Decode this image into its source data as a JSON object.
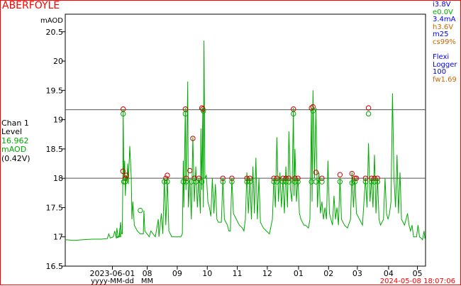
{
  "header": {
    "site_name": "ABERFOYLE",
    "timestamp": "2024-05-08 18:07:06"
  },
  "stats": [
    {
      "text": "i3.8V",
      "color": "#0000ff"
    },
    {
      "text": "e0.0V",
      "color": "#00aa00"
    },
    {
      "text": "3.4mA",
      "color": "#0000ff"
    },
    {
      "text": "h3.6V",
      "color": "#cc6600"
    },
    {
      "text": "m25",
      "color": "#0000ff"
    },
    {
      "text": "cs99%",
      "color": "#cc6600"
    },
    {
      "text": "",
      "color": "#000000"
    },
    {
      "text": "Flexi",
      "color": "#0000ff"
    },
    {
      "text": "Logger",
      "color": "#0000ff"
    },
    {
      "text": "100",
      "color": "#0000ff"
    },
    {
      "text": "fw1.69",
      "color": "#cc6600"
    }
  ],
  "channel": {
    "name": "Chan 1",
    "type": "Level",
    "value": "16.962",
    "unit": "mAOD",
    "voltage": "(0.42V)",
    "value_color": "#00aa00"
  },
  "chart_data": {
    "type": "line",
    "ylabel": "mAOD",
    "ylim": [
      16.5,
      20.8
    ],
    "yticks": [
      16.5,
      17,
      17.5,
      18,
      18.5,
      19,
      19.5,
      20,
      20.5
    ],
    "ytick_labels": [
      "16.5",
      "17",
      "17.5",
      "18",
      "18.5",
      "19",
      "19.5",
      "20",
      "20.5"
    ],
    "xlim": [
      0,
      12
    ],
    "xticks": [
      {
        "x": 1.57,
        "label": "2023-06-01"
      },
      {
        "x": 2.73,
        "label": "08"
      },
      {
        "x": 3.73,
        "label": "09"
      },
      {
        "x": 4.73,
        "label": "10"
      },
      {
        "x": 5.73,
        "label": "11"
      },
      {
        "x": 6.73,
        "label": "12"
      },
      {
        "x": 7.77,
        "label": "01"
      },
      {
        "x": 8.77,
        "label": "02"
      },
      {
        "x": 9.73,
        "label": "03"
      },
      {
        "x": 10.77,
        "label": "04"
      },
      {
        "x": 11.73,
        "label": "05"
      }
    ],
    "xaxis_format_labels": [
      {
        "x": 1.57,
        "label": "yyyy-MM-dd"
      },
      {
        "x": 2.73,
        "label": "MM"
      }
    ],
    "threshold_lines": [
      18.0,
      19.17
    ],
    "series": [
      {
        "color": "#00aa00",
        "points": [
          [
            0.0,
            16.95
          ],
          [
            0.3,
            16.94
          ],
          [
            0.6,
            16.95
          ],
          [
            0.9,
            16.96
          ],
          [
            1.2,
            16.96
          ],
          [
            1.4,
            16.97
          ],
          [
            1.45,
            17.05
          ],
          [
            1.5,
            16.98
          ],
          [
            1.6,
            17.0
          ],
          [
            1.65,
            17.1
          ],
          [
            1.7,
            16.98
          ],
          [
            1.8,
            17.0
          ],
          [
            1.82,
            17.15
          ],
          [
            1.85,
            17.0
          ],
          [
            1.7,
            17.0
          ],
          [
            1.72,
            17.15
          ],
          [
            1.76,
            17.0
          ],
          [
            1.82,
            17.02
          ],
          [
            1.84,
            17.25
          ],
          [
            1.88,
            17.05
          ],
          [
            1.9,
            17.05
          ],
          [
            1.92,
            18.1
          ],
          [
            1.93,
            19.18
          ],
          [
            1.95,
            18.0
          ],
          [
            1.98,
            18.3
          ],
          [
            2.0,
            17.7
          ],
          [
            2.03,
            18.05
          ],
          [
            2.05,
            17.95
          ],
          [
            2.08,
            18.25
          ],
          [
            2.1,
            17.9
          ],
          [
            2.15,
            18.55
          ],
          [
            2.2,
            18.0
          ],
          [
            2.22,
            17.3
          ],
          [
            2.25,
            17.6
          ],
          [
            2.3,
            17.2
          ],
          [
            2.4,
            17.1
          ],
          [
            2.5,
            17.05
          ],
          [
            2.6,
            17.05
          ],
          [
            2.62,
            17.45
          ],
          [
            2.65,
            17.1
          ],
          [
            2.8,
            17.0
          ],
          [
            2.85,
            17.1
          ],
          [
            3.0,
            17.0
          ],
          [
            3.1,
            17.3
          ],
          [
            3.12,
            17.0
          ],
          [
            3.2,
            17.4
          ],
          [
            3.25,
            17.05
          ],
          [
            3.3,
            18.0
          ],
          [
            3.35,
            17.2
          ],
          [
            3.4,
            18.0
          ],
          [
            3.45,
            17.1
          ],
          [
            3.5,
            17.05
          ],
          [
            3.55,
            17.0
          ],
          [
            3.6,
            17.0
          ],
          [
            3.65,
            17.0
          ],
          [
            3.7,
            17.0
          ],
          [
            3.8,
            17.0
          ],
          [
            3.85,
            17.0
          ],
          [
            3.9,
            17.05
          ],
          [
            3.93,
            18.3
          ],
          [
            3.95,
            17.5
          ],
          [
            4.0,
            19.2
          ],
          [
            4.02,
            17.8
          ],
          [
            4.05,
            18.5
          ],
          [
            4.08,
            19.65
          ],
          [
            4.1,
            17.5
          ],
          [
            4.15,
            18.0
          ],
          [
            4.2,
            17.3
          ],
          [
            4.25,
            18.7
          ],
          [
            4.3,
            17.6
          ],
          [
            4.35,
            18.2
          ],
          [
            4.4,
            17.5
          ],
          [
            4.45,
            18.0
          ],
          [
            4.5,
            17.4
          ],
          [
            4.52,
            18.85
          ],
          [
            4.55,
            17.8
          ],
          [
            4.58,
            19.2
          ],
          [
            4.6,
            17.5
          ],
          [
            4.62,
            20.35
          ],
          [
            4.65,
            18.0
          ],
          [
            4.7,
            18.05
          ],
          [
            4.75,
            17.6
          ],
          [
            4.8,
            17.5
          ],
          [
            4.85,
            17.35
          ],
          [
            4.9,
            18.0
          ],
          [
            4.95,
            17.4
          ],
          [
            5.0,
            17.9
          ],
          [
            5.05,
            17.3
          ],
          [
            5.1,
            17.25
          ],
          [
            5.2,
            17.25
          ],
          [
            5.25,
            18.0
          ],
          [
            5.3,
            17.3
          ],
          [
            5.4,
            17.2
          ],
          [
            5.45,
            17.1
          ],
          [
            5.5,
            17.1
          ],
          [
            5.55,
            18.0
          ],
          [
            5.6,
            17.4
          ],
          [
            5.7,
            17.3
          ],
          [
            5.8,
            17.2
          ],
          [
            5.9,
            17.15
          ],
          [
            5.95,
            17.1
          ],
          [
            6.0,
            17.3
          ],
          [
            6.05,
            18.1
          ],
          [
            6.1,
            17.4
          ],
          [
            6.15,
            18.0
          ],
          [
            6.2,
            17.3
          ],
          [
            6.25,
            18.2
          ],
          [
            6.3,
            17.4
          ],
          [
            6.35,
            18.35
          ],
          [
            6.4,
            17.3
          ],
          [
            6.45,
            18.0
          ],
          [
            6.5,
            17.25
          ],
          [
            6.55,
            17.2
          ],
          [
            6.6,
            17.15
          ],
          [
            6.7,
            17.1
          ],
          [
            6.8,
            17.05
          ],
          [
            6.9,
            17.3
          ],
          [
            6.95,
            18.0
          ],
          [
            7.0,
            17.5
          ],
          [
            7.05,
            18.7
          ],
          [
            7.1,
            17.6
          ],
          [
            7.15,
            18.1
          ],
          [
            7.2,
            17.5
          ],
          [
            7.25,
            18.0
          ],
          [
            7.3,
            17.4
          ],
          [
            7.35,
            18.2
          ],
          [
            7.4,
            17.5
          ],
          [
            7.45,
            18.8
          ],
          [
            7.5,
            17.8
          ],
          [
            7.55,
            17.6
          ],
          [
            7.6,
            19.2
          ],
          [
            7.62,
            17.7
          ],
          [
            7.65,
            18.5
          ],
          [
            7.7,
            17.6
          ],
          [
            7.75,
            18.0
          ],
          [
            7.8,
            17.4
          ],
          [
            7.85,
            17.3
          ],
          [
            7.9,
            17.25
          ],
          [
            7.95,
            17.2
          ],
          [
            8.0,
            17.2
          ],
          [
            8.1,
            17.15
          ],
          [
            8.15,
            17.3
          ],
          [
            8.2,
            19.2
          ],
          [
            8.22,
            17.6
          ],
          [
            8.25,
            19.5
          ],
          [
            8.3,
            18.0
          ],
          [
            8.35,
            19.2
          ],
          [
            8.4,
            17.5
          ],
          [
            8.45,
            18.1
          ],
          [
            8.5,
            17.4
          ],
          [
            8.55,
            17.6
          ],
          [
            8.6,
            17.3
          ],
          [
            8.65,
            17.5
          ],
          [
            8.7,
            17.3
          ],
          [
            8.75,
            18.3
          ],
          [
            8.8,
            17.4
          ],
          [
            8.85,
            17.3
          ],
          [
            8.9,
            17.2
          ],
          [
            8.95,
            17.7
          ],
          [
            9.0,
            17.3
          ],
          [
            9.05,
            17.5
          ],
          [
            9.1,
            17.2
          ],
          [
            9.15,
            18.0
          ],
          [
            9.2,
            17.3
          ],
          [
            9.3,
            17.2
          ],
          [
            9.4,
            17.15
          ],
          [
            9.5,
            17.3
          ],
          [
            9.55,
            18.1
          ],
          [
            9.6,
            17.5
          ],
          [
            9.65,
            18.0
          ],
          [
            9.7,
            17.4
          ],
          [
            9.8,
            17.3
          ],
          [
            9.9,
            17.2
          ],
          [
            10.0,
            18.0
          ],
          [
            10.05,
            17.5
          ],
          [
            10.1,
            18.6
          ],
          [
            10.15,
            17.6
          ],
          [
            10.2,
            18.0
          ],
          [
            10.25,
            17.5
          ],
          [
            10.3,
            18.4
          ],
          [
            10.35,
            17.4
          ],
          [
            10.4,
            18.0
          ],
          [
            10.45,
            17.3
          ],
          [
            10.5,
            17.2
          ],
          [
            10.6,
            17.3
          ],
          [
            10.65,
            18.0
          ],
          [
            10.7,
            17.4
          ],
          [
            10.75,
            17.3
          ],
          [
            10.8,
            17.4
          ],
          [
            10.85,
            17.6
          ],
          [
            10.9,
            19.45
          ],
          [
            10.95,
            18.0
          ],
          [
            11.0,
            17.5
          ],
          [
            11.05,
            18.4
          ],
          [
            11.1,
            17.4
          ],
          [
            11.15,
            18.1
          ],
          [
            11.2,
            17.3
          ],
          [
            11.3,
            17.2
          ],
          [
            11.4,
            17.4
          ],
          [
            11.45,
            17.2
          ],
          [
            11.5,
            17.1
          ],
          [
            11.55,
            17.2
          ],
          [
            11.6,
            17.0
          ],
          [
            11.7,
            17.0
          ],
          [
            11.75,
            17.2
          ],
          [
            11.8,
            17.0
          ],
          [
            11.85,
            16.98
          ],
          [
            11.9,
            16.95
          ],
          [
            11.95,
            17.1
          ],
          [
            11.98,
            16.97
          ]
        ]
      }
    ],
    "markers": [
      {
        "type": "circle",
        "color": "#cc0000",
        "points": [
          [
            1.93,
            19.18
          ],
          [
            1.92,
            18.12
          ],
          [
            2.0,
            18.0
          ],
          [
            2.03,
            18.05
          ],
          [
            3.4,
            18.05
          ],
          [
            3.35,
            18.0
          ],
          [
            4.0,
            19.18
          ],
          [
            4.03,
            18.0
          ],
          [
            4.15,
            18.13
          ],
          [
            4.25,
            18.68
          ],
          [
            4.3,
            18.0
          ],
          [
            4.45,
            18.0
          ],
          [
            4.55,
            19.2
          ],
          [
            4.58,
            19.18
          ],
          [
            5.25,
            18.0
          ],
          [
            5.55,
            18.0
          ],
          [
            6.05,
            18.0
          ],
          [
            6.15,
            18.0
          ],
          [
            6.95,
            18.0
          ],
          [
            7.05,
            18.0
          ],
          [
            7.25,
            18.0
          ],
          [
            7.35,
            18.0
          ],
          [
            7.45,
            18.0
          ],
          [
            7.6,
            19.18
          ],
          [
            7.65,
            18.0
          ],
          [
            7.75,
            18.0
          ],
          [
            8.2,
            19.2
          ],
          [
            8.25,
            19.22
          ],
          [
            8.35,
            18.1
          ],
          [
            8.55,
            18.0
          ],
          [
            9.15,
            18.06
          ],
          [
            9.55,
            18.08
          ],
          [
            9.65,
            18.0
          ],
          [
            9.7,
            18.0
          ],
          [
            10.0,
            18.0
          ],
          [
            10.1,
            19.2
          ],
          [
            10.2,
            18.0
          ],
          [
            10.3,
            18.0
          ],
          [
            10.4,
            18.0
          ]
        ]
      },
      {
        "type": "circle",
        "color": "#00aa00",
        "points": [
          [
            1.93,
            19.1
          ],
          [
            1.95,
            17.94
          ],
          [
            2.0,
            17.94
          ],
          [
            2.5,
            17.45
          ],
          [
            3.3,
            17.94
          ],
          [
            3.4,
            17.94
          ],
          [
            4.0,
            19.1
          ],
          [
            3.93,
            17.94
          ],
          [
            4.02,
            17.94
          ],
          [
            4.2,
            17.94
          ],
          [
            4.35,
            17.94
          ],
          [
            4.6,
            19.15
          ],
          [
            4.55,
            17.94
          ],
          [
            5.25,
            17.94
          ],
          [
            5.55,
            17.94
          ],
          [
            6.05,
            17.94
          ],
          [
            6.15,
            17.94
          ],
          [
            6.95,
            17.94
          ],
          [
            7.05,
            17.94
          ],
          [
            7.25,
            17.94
          ],
          [
            7.35,
            17.94
          ],
          [
            7.45,
            17.94
          ],
          [
            7.6,
            19.1
          ],
          [
            7.65,
            17.94
          ],
          [
            7.75,
            17.94
          ],
          [
            8.2,
            17.94
          ],
          [
            8.25,
            19.15
          ],
          [
            8.35,
            17.94
          ],
          [
            8.55,
            17.94
          ],
          [
            9.15,
            17.94
          ],
          [
            9.55,
            17.92
          ],
          [
            9.65,
            17.94
          ],
          [
            10.0,
            17.94
          ],
          [
            10.1,
            19.1
          ],
          [
            10.2,
            17.94
          ],
          [
            10.3,
            17.94
          ],
          [
            10.4,
            17.94
          ]
        ]
      }
    ],
    "grid": false
  }
}
